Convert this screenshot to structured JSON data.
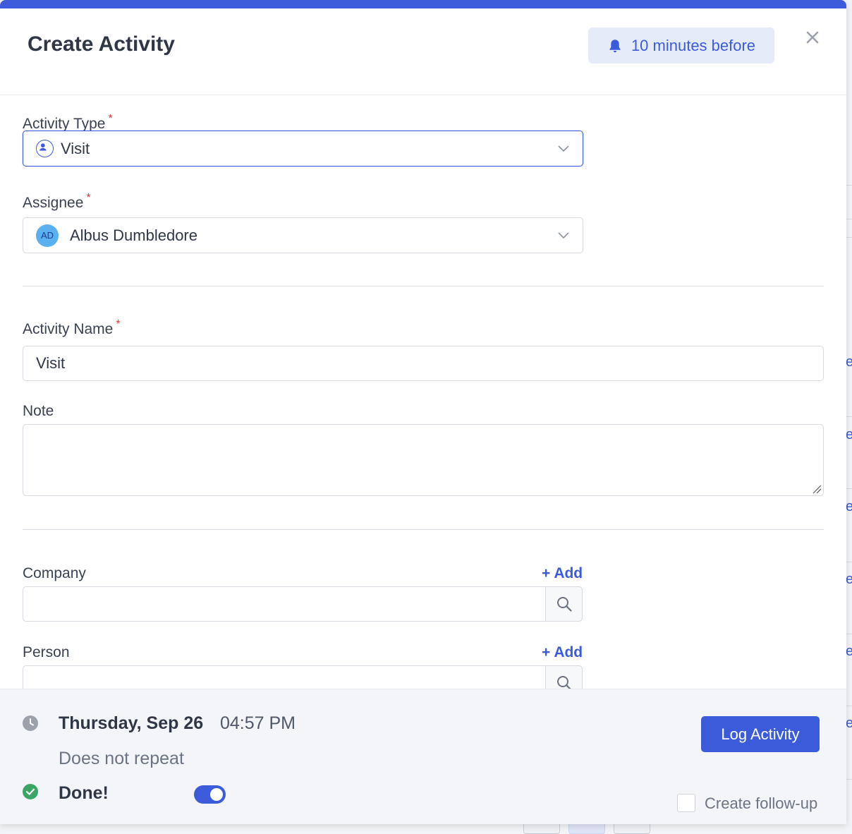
{
  "modal": {
    "title": "Create Activity",
    "reminder_label": "10 minutes before"
  },
  "form": {
    "activity_type": {
      "label": "Activity Type",
      "required_mark": "*",
      "value": "Visit"
    },
    "assignee": {
      "label": "Assignee",
      "required_mark": "*",
      "avatar_initials": "AD",
      "value": "Albus Dumbledore"
    },
    "activity_name": {
      "label": "Activity Name",
      "required_mark": "*",
      "value": "Visit"
    },
    "note": {
      "label": "Note",
      "value": ""
    },
    "company": {
      "label": "Company",
      "add_label": "+ Add",
      "value": ""
    },
    "person": {
      "label": "Person",
      "add_label": "+ Add",
      "value": ""
    }
  },
  "footer": {
    "date": "Thursday, Sep 26",
    "time": "04:57 PM",
    "repeat": "Does not repeat",
    "done_label": "Done!",
    "done_toggle_on": true,
    "log_button": "Log Activity",
    "followup_label": "Create follow-up"
  },
  "background": {
    "edge_letters": [
      "e",
      "e",
      "e",
      "e",
      "e",
      "e"
    ]
  },
  "colors": {
    "accent": "#3b5bdb",
    "required": "#e03b3b",
    "done_green": "#3aa564",
    "avatar": "#5ab0f0"
  },
  "icons": {
    "reminder": "bell-icon",
    "close": "close-icon",
    "activity_type": "person-circle-icon",
    "dropdown": "chevron-down-icon",
    "search": "search-icon",
    "clock": "clock-icon",
    "done": "check-circle-icon"
  }
}
